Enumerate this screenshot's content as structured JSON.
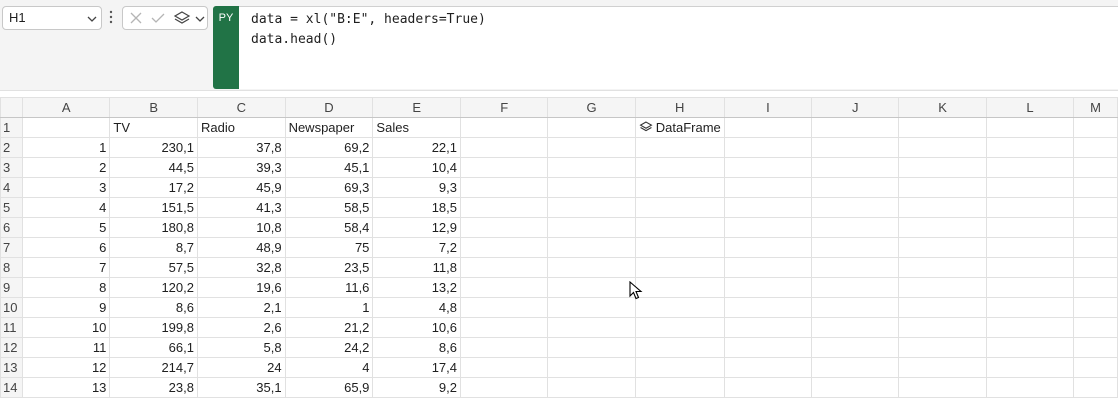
{
  "namebox": {
    "value": "H1"
  },
  "python": {
    "badge": "PY",
    "code_lines": [
      "data = xl(\"B:E\", headers=True)",
      "data.head()"
    ]
  },
  "columns": [
    "A",
    "B",
    "C",
    "D",
    "E",
    "F",
    "G",
    "H",
    "I",
    "J",
    "K",
    "L",
    "M"
  ],
  "row_numbers": [
    "1",
    "2",
    "3",
    "4",
    "5",
    "6",
    "7",
    "8",
    "9",
    "10",
    "11",
    "12",
    "13",
    "14"
  ],
  "headers": [
    "TV",
    "Radio",
    "Newspaper",
    "Sales"
  ],
  "rows": [
    [
      "1",
      "230,1",
      "37,8",
      "69,2",
      "22,1"
    ],
    [
      "2",
      "44,5",
      "39,3",
      "45,1",
      "10,4"
    ],
    [
      "3",
      "17,2",
      "45,9",
      "69,3",
      "9,3"
    ],
    [
      "4",
      "151,5",
      "41,3",
      "58,5",
      "18,5"
    ],
    [
      "5",
      "180,8",
      "10,8",
      "58,4",
      "12,9"
    ],
    [
      "6",
      "8,7",
      "48,9",
      "75",
      "7,2"
    ],
    [
      "7",
      "57,5",
      "32,8",
      "23,5",
      "11,8"
    ],
    [
      "8",
      "120,2",
      "19,6",
      "11,6",
      "13,2"
    ],
    [
      "9",
      "8,6",
      "2,1",
      "1",
      "4,8"
    ],
    [
      "10",
      "199,8",
      "2,6",
      "21,2",
      "10,6"
    ],
    [
      "11",
      "66,1",
      "5,8",
      "24,2",
      "8,6"
    ],
    [
      "12",
      "214,7",
      "24",
      "4",
      "17,4"
    ],
    [
      "13",
      "23,8",
      "35,1",
      "65,9",
      "9,2"
    ]
  ],
  "dataframe_cell": {
    "label": "DataFrame",
    "icon": "dataframe-stack-icon"
  }
}
